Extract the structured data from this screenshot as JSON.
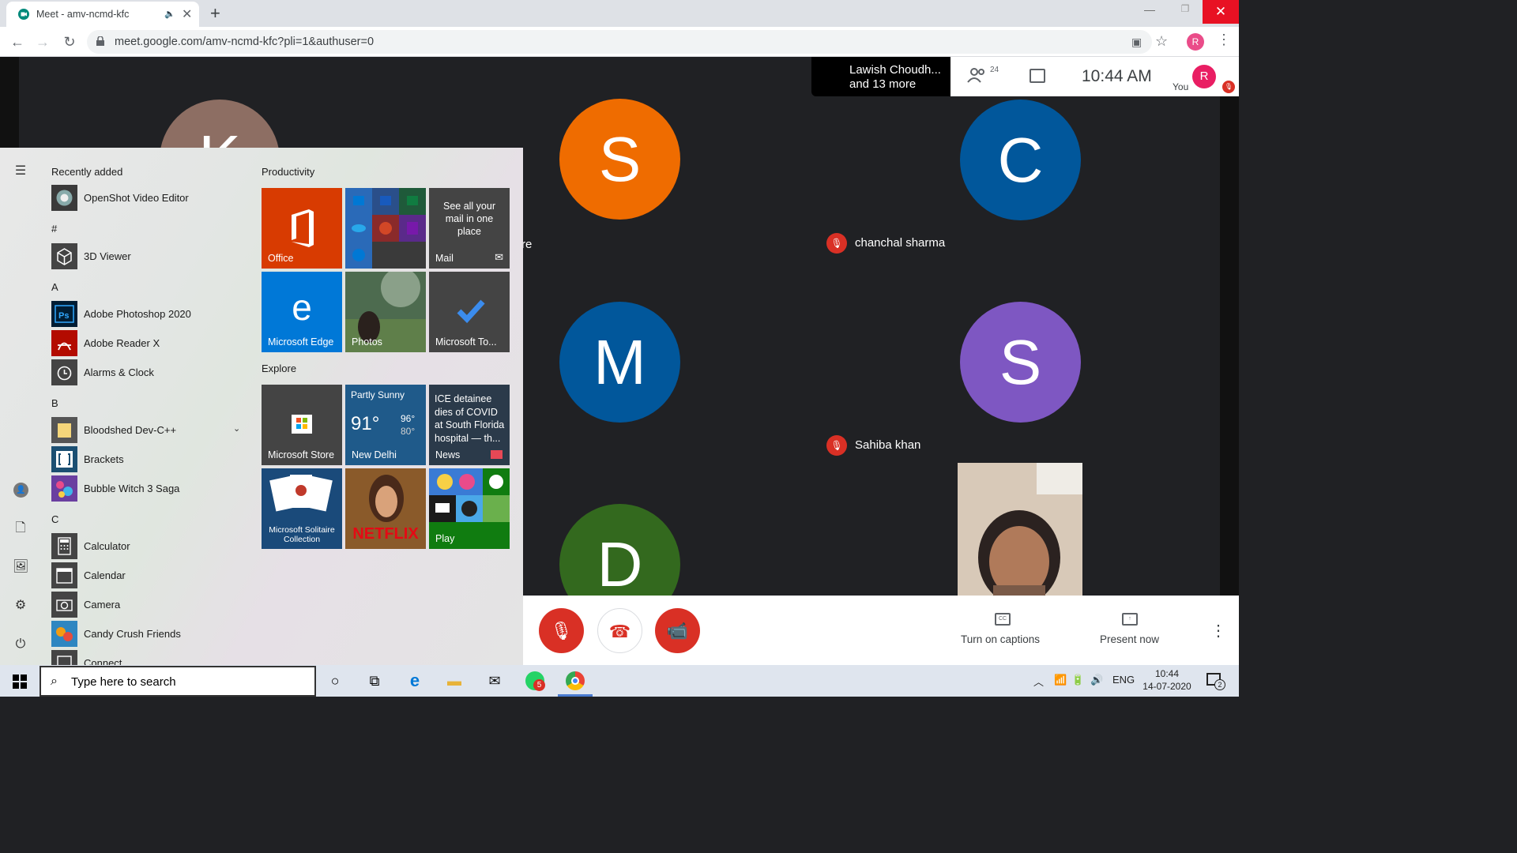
{
  "browser": {
    "tab_title": "Meet - amv-ncmd-kfc",
    "new_tab_symbol": "+",
    "url": "meet.google.com/amv-ncmd-kfc?pli=1&authuser=0",
    "profile_initial": "R"
  },
  "meet": {
    "speaker_line1": "Lawish Choudh...",
    "speaker_line2": "and 13 more",
    "participant_count": "24",
    "time": "10:44  AM",
    "you_label": "You",
    "my_initial": "R",
    "tiles": [
      {
        "initial": "K",
        "color": "#8d6e63"
      },
      {
        "initial": "S",
        "color": "#ef6c00"
      },
      {
        "initial": "C",
        "color": "#01579b"
      },
      {
        "initial": "M",
        "color": "#01579b"
      },
      {
        "initial": "S",
        "color": "#7e57c2"
      },
      {
        "initial": "D",
        "color": "#33691e"
      }
    ],
    "names": [
      "chanchal sharma",
      "Sahiba khan"
    ],
    "cut_text": "re",
    "controls": {
      "captions_label": "Turn on captions",
      "present_label": "Present now",
      "cc_text": "CC"
    }
  },
  "start_menu": {
    "recently_added": "Recently added",
    "apps": [
      {
        "letter": "",
        "name": "OpenShot Video Editor"
      },
      {
        "letter": "#",
        "name": "3D Viewer"
      },
      {
        "letter": "A",
        "name": "Adobe Photoshop 2020"
      },
      {
        "letter": "",
        "name": "Adobe Reader X"
      },
      {
        "letter": "",
        "name": "Alarms & Clock"
      },
      {
        "letter": "B",
        "name": "Bloodshed Dev-C++"
      },
      {
        "letter": "",
        "name": "Brackets"
      },
      {
        "letter": "",
        "name": "Bubble Witch 3 Saga"
      },
      {
        "letter": "C",
        "name": "Calculator"
      },
      {
        "letter": "",
        "name": "Calendar"
      },
      {
        "letter": "",
        "name": "Camera"
      },
      {
        "letter": "",
        "name": "Candy Crush Friends"
      },
      {
        "letter": "",
        "name": "Connect"
      }
    ],
    "letters": {
      "hash": "#",
      "a": "A",
      "b": "B",
      "c": "C"
    },
    "ps_badge": "Ps",
    "groups": {
      "productivity": "Productivity",
      "explore": "Explore"
    },
    "tiles": {
      "office": "Office",
      "mail_text": "See all your mail in one place",
      "mail": "Mail",
      "edge": "Microsoft Edge",
      "photos": "Photos",
      "todo": "Microsoft To...",
      "store": "Microsoft Store",
      "weather_cond": "Partly Sunny",
      "weather_temp": "91°",
      "weather_hi": "96°",
      "weather_lo": "80°",
      "weather_city": "New Delhi",
      "news_text": "ICE detainee dies of COVID at South Florida hospital — th...",
      "news": "News",
      "solitaire": "Microsoft Solitaire Collection",
      "netflix": "NETFLIX",
      "play": "Play"
    }
  },
  "taskbar": {
    "search_placeholder": "Type here to search",
    "whatsapp_badge": "5",
    "lang": "ENG",
    "time": "10:44",
    "date": "14-07-2020",
    "notif_count": "2"
  }
}
